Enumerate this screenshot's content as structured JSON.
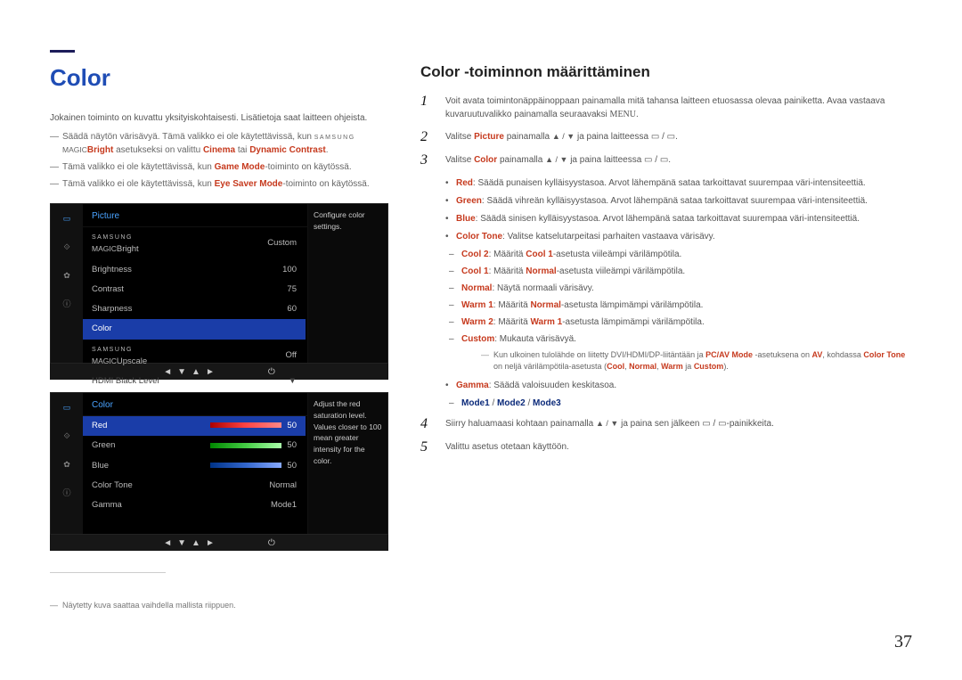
{
  "page_number": "37",
  "left": {
    "heading": "Color",
    "intro": "Jokainen toiminto on kuvattu yksityiskohtaisesti. Lisätietoja saat laitteen ohjeista.",
    "notes": [
      {
        "pre": "Säädä näytön värisävyä. Tämä valikko ei ole käytettävissä, kun ",
        "magic_small": "SAMSUNG",
        "magic": "MAGIC",
        "hl1": "Bright",
        "mid": " asetukseksi on valittu ",
        "hl2": "Cinema",
        "mid2": " tai ",
        "hl3": "Dynamic Contrast",
        "post": "."
      },
      {
        "plain_pre": "Tämä valikko ei ole käytettävissä, kun ",
        "hl": "Game Mode",
        "plain_post": "-toiminto on käytössä."
      },
      {
        "plain_pre": "Tämä valikko ei ole käytettävissä, kun ",
        "hl": "Eye Saver Mode",
        "plain_post": "-toiminto on käytössä."
      }
    ],
    "osd1": {
      "title": "Picture",
      "desc": "Configure color settings.",
      "rows": [
        {
          "label_magic_small": "SAMSUNG",
          "label_magic": "MAGIC",
          "label_suffix": "Bright",
          "value": "Custom"
        },
        {
          "label": "Brightness",
          "value": "100"
        },
        {
          "label": "Contrast",
          "value": "75"
        },
        {
          "label": "Sharpness",
          "value": "60"
        },
        {
          "label": "Color",
          "value": "",
          "selected": true
        },
        {
          "label_magic_small": "SAMSUNG",
          "label_magic": "MAGIC",
          "label_suffix": "Upscale",
          "value": "Off"
        },
        {
          "label": "HDMI Black Level",
          "value": "",
          "dim": true
        }
      ]
    },
    "osd2": {
      "title": "Color",
      "desc": "Adjust the red saturation level. Values closer to 100 mean greater intensity for the color.",
      "rows": [
        {
          "label": "Red",
          "value": "50",
          "bar": "red",
          "selected": true
        },
        {
          "label": "Green",
          "value": "50",
          "bar": "green"
        },
        {
          "label": "Blue",
          "value": "50",
          "bar": "blue"
        },
        {
          "label": "Color Tone",
          "value": "Normal"
        },
        {
          "label": "Gamma",
          "value": "Mode1"
        }
      ]
    },
    "nav_icons": [
      "◄",
      "▼",
      "▲",
      "►"
    ],
    "power_icon": "⏻",
    "footnote": "Näytetty kuva saattaa vaihdella mallista riippuen."
  },
  "right": {
    "heading": "Color -toiminnon määrittäminen",
    "steps": {
      "s1": {
        "pre": "Voit avata toimintonäppäinoppaan painamalla mitä tahansa laitteen etuosassa olevaa painiketta. Avaa vastaava kuvaruutuvalikko painamalla seuraavaksi ",
        "menu": "MENU",
        "post": "."
      },
      "s2": {
        "pre": "Valitse ",
        "hl": "Picture",
        "mid": " painamalla ",
        "arrows": "▲ / ▼",
        "mid2": " ja paina laitteessa ",
        "btns": "▭ / ▭",
        "post": "."
      },
      "s3": {
        "pre": "Valitse ",
        "hl": "Color",
        "mid": " painamalla ",
        "arrows": "▲ / ▼",
        "mid2": " ja paina laitteessa ",
        "btns": "▭ / ▭",
        "post": "."
      },
      "s4": {
        "pre": "Siirry haluamaasi kohtaan painamalla ",
        "arrows": "▲ / ▼",
        "mid": " ja paina sen jälkeen ",
        "btns": "▭ / ▭",
        "post": "-painikkeita."
      },
      "s5": "Valittu asetus otetaan käyttöön."
    },
    "bullets": {
      "red": {
        "hl": "Red",
        "text": ": Säädä punaisen kylläisyystasoa. Arvot lähempänä sataa tarkoittavat suurempaa väri-intensiteettiä."
      },
      "green": {
        "hl": "Green",
        "text": ": Säädä vihreän kylläisyystasoa. Arvot lähempänä sataa tarkoittavat suurempaa väri-intensiteettiä."
      },
      "blue": {
        "hl": "Blue",
        "text": ": Säädä sinisen kylläisyystasoa. Arvot lähempänä sataa tarkoittavat suurempaa väri-intensiteettiä."
      },
      "colortone": {
        "hl": "Color Tone",
        "text": ": Valitse katselutarpeitasi parhaiten vastaava värisävy."
      },
      "ct_sub": [
        {
          "hl": "Cool 2",
          "pre": ": Määritä ",
          "hl2": "Cool 1",
          "post": "-asetusta viileämpi värilämpötila."
        },
        {
          "hl": "Cool 1",
          "pre": ": Määritä ",
          "hl2": "Normal",
          "post": "-asetusta viileämpi värilämpötila."
        },
        {
          "hl": "Normal",
          "post": ": Näytä normaali värisävy."
        },
        {
          "hl": "Warm 1",
          "pre": ": Määritä ",
          "hl2": "Normal",
          "post": "-asetusta lämpimämpi värilämpötila."
        },
        {
          "hl": "Warm 2",
          "pre": ": Määritä ",
          "hl2": "Warm 1",
          "post": "-asetusta lämpimämpi värilämpötila."
        },
        {
          "hl": "Custom",
          "post": ": Mukauta värisävyä."
        }
      ],
      "tip": {
        "pre": "Kun ulkoinen tulolähde on liitetty DVI/HDMI/DP-liitäntään ja ",
        "hl1": "PC/AV Mode",
        "mid": " -asetuksena on ",
        "hl2": "AV",
        "mid2": ", kohdassa ",
        "hl3": "Color Tone",
        "mid3": " on neljä värilämpötila-asetusta (",
        "c1": "Cool",
        "c2": "Normal",
        "c3": "Warm",
        "c4": "Custom",
        "post": ")."
      },
      "gamma": {
        "hl": "Gamma",
        "text": ": Säädä valoisuuden keskitasoa."
      },
      "gamma_sub": {
        "m1": "Mode1",
        "m2": "Mode2",
        "m3": "Mode3"
      }
    }
  }
}
